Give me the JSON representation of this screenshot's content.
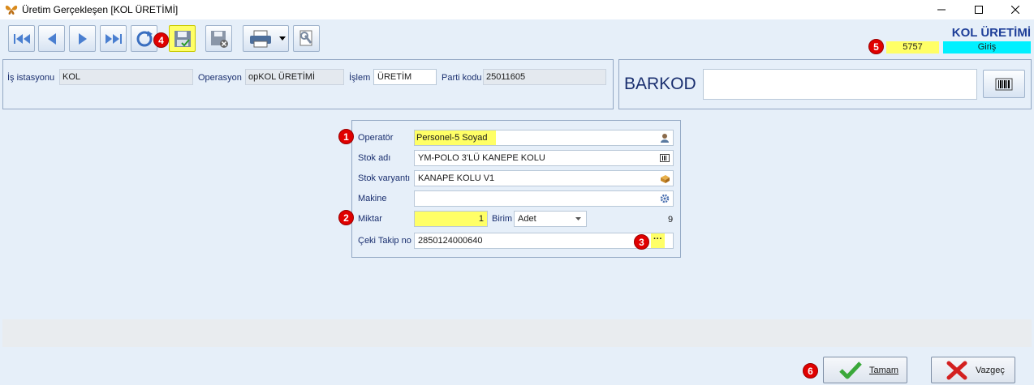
{
  "window": {
    "title": "Üretim Gerçekleşen [KOL ÜRETİMİ]"
  },
  "icons": {
    "app": "butterfly-icon",
    "minimize": "minimize-icon",
    "maximize": "maximize-icon",
    "close": "close-icon",
    "first": "first-record-icon",
    "prev": "previous-record-icon",
    "next": "next-record-icon",
    "last": "last-record-icon",
    "refresh": "refresh-icon",
    "save": "save-icon",
    "delete": "save-delete-icon",
    "print": "printer-icon",
    "dropdown": "dropdown-arrow-icon",
    "tools": "wrench-icon",
    "barcode": "barcode-icon",
    "person": "person-icon",
    "list": "list-icon",
    "box": "box-icon",
    "gear": "gear-icon",
    "check": "checkmark-icon",
    "cross": "cross-icon"
  },
  "colors": {
    "highlight": "#ffff66",
    "badge": "#e00000",
    "status_cyan": "#00f0ff",
    "header_blue": "#1f3f99"
  },
  "header": {
    "module_title": "KOL ÜRETİMİ",
    "number": "5757",
    "status": "Giriş"
  },
  "top_panel": {
    "workstation_label": "İş istasyonu",
    "workstation_value": "KOL",
    "operation_label": "Operasyon",
    "operation_value": "opKOL ÜRETİMİ",
    "process_label": "İşlem",
    "process_value": "ÜRETİM",
    "lot_label": "Parti kodu",
    "lot_value": "25011605"
  },
  "barcode_panel": {
    "label": "BARKOD",
    "value": ""
  },
  "form": {
    "operator_label": "Operatör",
    "operator_value": "Personel-5 Soyad",
    "stock_label": "Stok adı",
    "stock_value": "YM-POLO 3'LÜ KANEPE KOLU",
    "variant_label": "Stok varyantı",
    "variant_value": "KANAPE KOLU V1",
    "machine_label": "Makine",
    "machine_value": "",
    "quantity_label": "Miktar",
    "quantity_value": "1",
    "unit_label": "Birim",
    "unit_value": "Adet",
    "unit_extra": "9",
    "tracking_label": "Çeki Takip no",
    "tracking_value": "2850124000640",
    "ellipsis": "···"
  },
  "badges": {
    "b1": "1",
    "b2": "2",
    "b3": "3",
    "b4": "4",
    "b5": "5",
    "b6": "6"
  },
  "buttons": {
    "ok": "Tamam",
    "cancel": "Vazgeç"
  }
}
